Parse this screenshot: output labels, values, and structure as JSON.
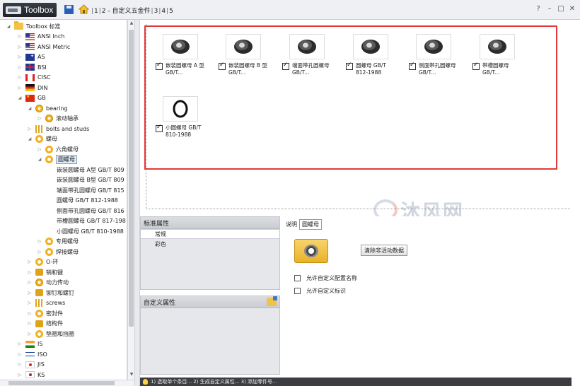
{
  "titlebar": {
    "app_title": "Toolbox",
    "breadcrumbs": [
      "1",
      "2 - 自定义五金件",
      "3",
      "4",
      "5"
    ],
    "help": "?",
    "window_buttons": [
      "minimize-icon",
      "restore-icon",
      "close-icon"
    ]
  },
  "tree": {
    "items": [
      {
        "label": "Toolbox 标准",
        "icon": "folder-icon",
        "twisty": "open"
      },
      {
        "label": "ANSI Inch",
        "icon": "flag-us-icon",
        "twisty": "closed"
      },
      {
        "label": "ANSI Metric",
        "icon": "flag-us-icon",
        "twisty": "closed"
      },
      {
        "label": "AS",
        "icon": "flag-au-icon",
        "twisty": "closed"
      },
      {
        "label": "BSI",
        "icon": "flag-gb-icon",
        "twisty": "closed"
      },
      {
        "label": "CISC",
        "icon": "flag-ca-icon",
        "twisty": "closed"
      },
      {
        "label": "DIN",
        "icon": "flag-de-icon",
        "twisty": "closed"
      },
      {
        "label": "GB",
        "icon": "flag-cn-icon",
        "twisty": "open"
      },
      {
        "label": "bearing",
        "icon": "gear-icon",
        "twisty": "open"
      },
      {
        "label": "滚动轴承",
        "icon": "gear-icon",
        "twisty": "closed"
      },
      {
        "label": "bolts and studs",
        "icon": "bolts-icon",
        "twisty": "closed"
      },
      {
        "label": "螺母",
        "icon": "ring-icon",
        "twisty": "open"
      },
      {
        "label": "六角螺母",
        "icon": "ring-icon",
        "twisty": "closed"
      },
      {
        "label": "圆螺母",
        "icon": "ring-icon",
        "twisty": "open"
      },
      {
        "label": "嵌装圆螺母 A型 GB/T 809",
        "icon": "",
        "twisty": ""
      },
      {
        "label": "嵌装圆螺母 B型 GB/T 809",
        "icon": "",
        "twisty": ""
      },
      {
        "label": "端面带孔圆螺母 GB/T 815",
        "icon": "",
        "twisty": ""
      },
      {
        "label": "圆螺母 GB/T 812-1988",
        "icon": "",
        "twisty": ""
      },
      {
        "label": "侧面带孔圆螺母 GB/T 816",
        "icon": "",
        "twisty": ""
      },
      {
        "label": "带槽圆螺母 GB/T 817-198",
        "icon": "",
        "twisty": ""
      },
      {
        "label": "小圆螺母 GB/T 810-1988",
        "icon": "",
        "twisty": ""
      },
      {
        "label": "专用螺母",
        "icon": "ring-icon",
        "twisty": "closed"
      },
      {
        "label": "焊接螺母",
        "icon": "ring-icon",
        "twisty": "closed"
      },
      {
        "label": "O-环",
        "icon": "ring-icon",
        "twisty": "closed"
      },
      {
        "label": "销和键",
        "icon": "small-icon",
        "twisty": "closed"
      },
      {
        "label": "动力传动",
        "icon": "gear-icon",
        "twisty": "closed"
      },
      {
        "label": "铆钉和螺钉",
        "icon": "small-icon",
        "twisty": "closed"
      },
      {
        "label": "screws",
        "icon": "bolts-icon",
        "twisty": "closed"
      },
      {
        "label": "密封件",
        "icon": "ring-icon",
        "twisty": "closed"
      },
      {
        "label": "结构件",
        "icon": "small-icon",
        "twisty": "closed"
      },
      {
        "label": "垫圈和挡圈",
        "icon": "ring-icon",
        "twisty": "closed"
      },
      {
        "label": "IS",
        "icon": "flag-in-icon",
        "twisty": "closed"
      },
      {
        "label": "ISO",
        "icon": "flag-il-icon",
        "twisty": "closed"
      },
      {
        "label": "JIS",
        "icon": "flag-jp-icon",
        "twisty": "closed"
      },
      {
        "label": "KS",
        "icon": "flag-kr-icon",
        "twisty": "closed"
      }
    ]
  },
  "grid": {
    "items": [
      {
        "label": "嵌装圆螺母 A 型 GB/T...",
        "checked": true
      },
      {
        "label": "嵌装圆螺母 B 型 GB/T...",
        "checked": true
      },
      {
        "label": "端面带孔圆螺母 GB/T...",
        "checked": true
      },
      {
        "label": "圆螺母 GB/T 812-1988",
        "checked": true
      },
      {
        "label": "侧面带孔圆螺母 GB/T...",
        "checked": true
      },
      {
        "label": "带槽圆螺母 GB/T...",
        "checked": true
      },
      {
        "label": "小圆螺母 GB/T 810-1988",
        "checked": true
      }
    ]
  },
  "watermark": {
    "main": "沐风网",
    "url": "www.mfcad.com"
  },
  "std_props": {
    "title": "标准属性",
    "items": [
      "常规",
      "彩色"
    ]
  },
  "custom_props": {
    "title": "自定义属性"
  },
  "detail": {
    "desc_label": "说明",
    "desc_value": "圆螺母",
    "clear_button": "清除非活动数据",
    "options": [
      "允许自定义配置名称",
      "允许自定义标识"
    ]
  },
  "status": {
    "text": "1) 选取单个条目... 2) 生成自定义属性... 3) 添加零件号..."
  },
  "colors": {
    "highlight_border": "#e23a3a",
    "folder": "#f5c342",
    "status_bg": "#3b3d42"
  }
}
